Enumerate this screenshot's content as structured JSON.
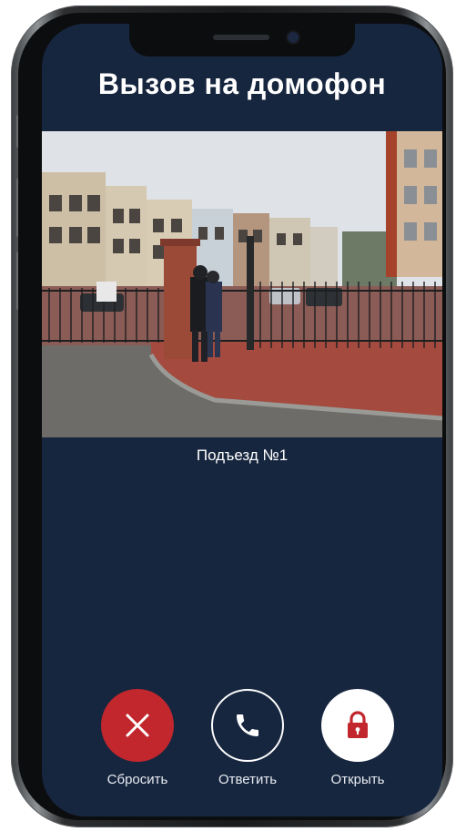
{
  "screen": {
    "title": "Вызов на домофон",
    "camera_feed": {
      "caption": "Подъезд №1"
    }
  },
  "actions": [
    {
      "label": "Сбросить",
      "icon": "close-icon",
      "color": "#c1272d"
    },
    {
      "label": "Ответить",
      "icon": "phone-icon",
      "color": "#ffffff"
    },
    {
      "label": "Открыть",
      "icon": "lock-icon",
      "color": "#c1272d"
    }
  ],
  "colors": {
    "background": "#17263f",
    "reject": "#c1272d",
    "text": "#ffffff"
  }
}
